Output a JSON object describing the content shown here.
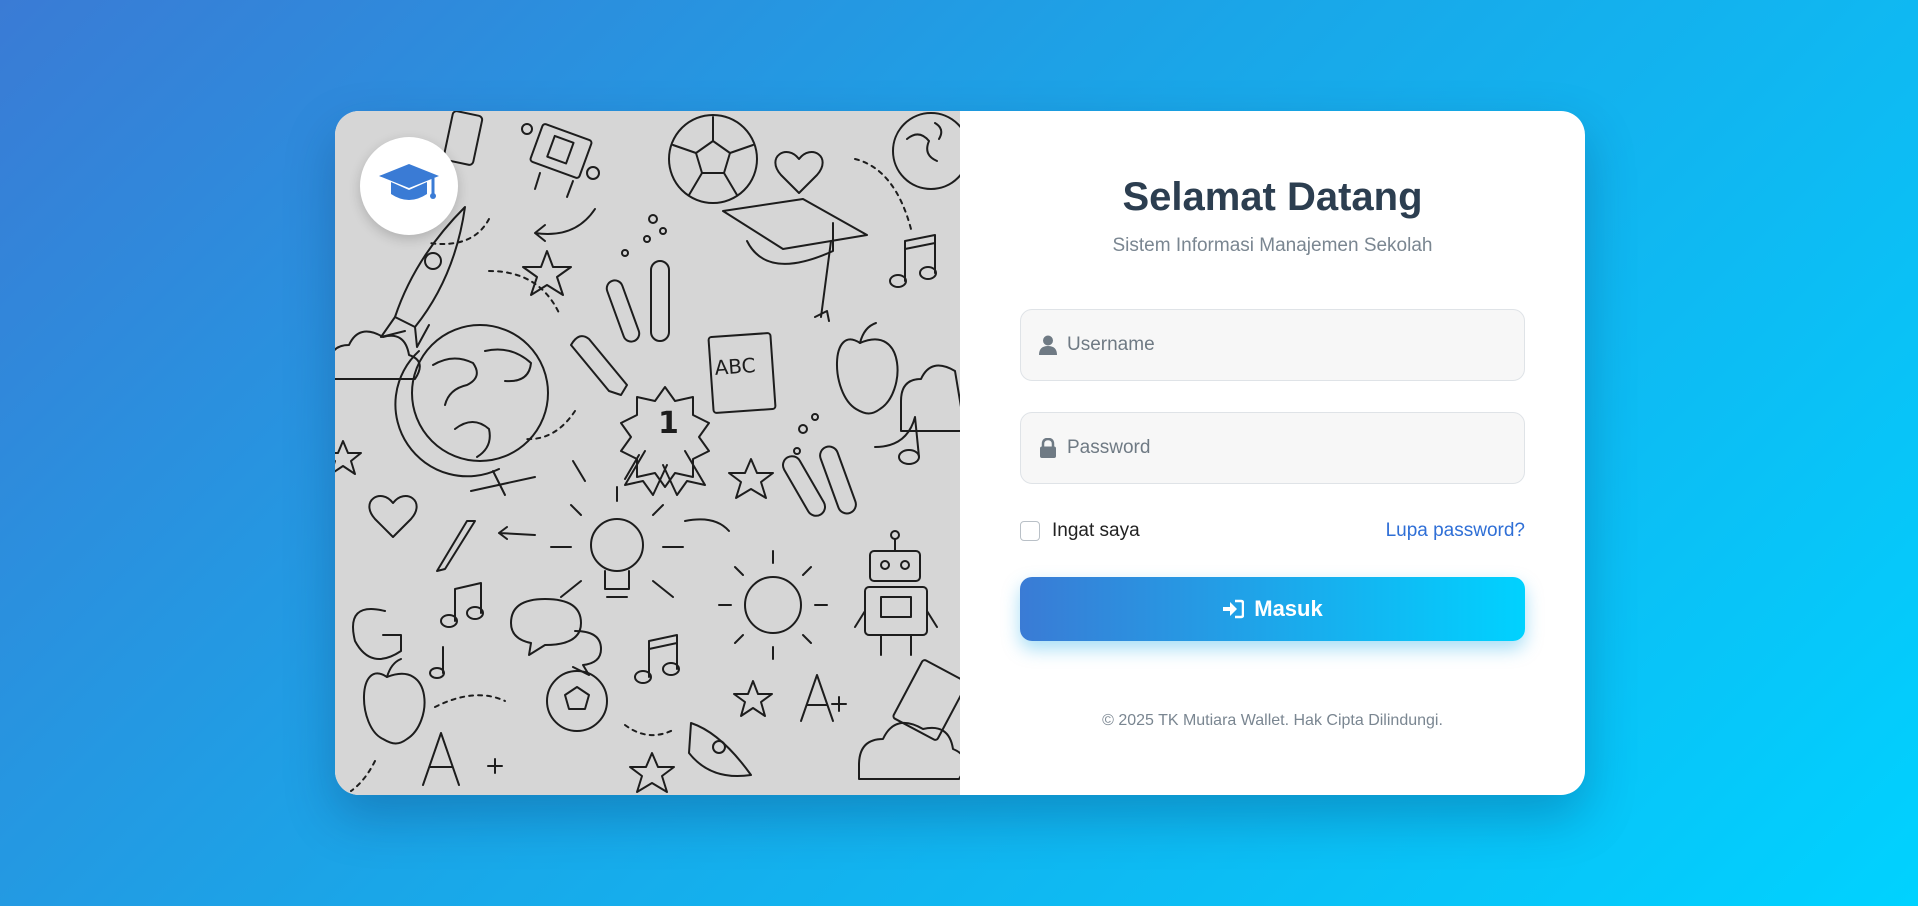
{
  "brand": {
    "logo_icon": "graduation-cap-icon",
    "accent_color": "#3a7bd5",
    "accent_color_end": "#00d2ff"
  },
  "header": {
    "title": "Selamat Datang",
    "subtitle": "Sistem Informasi Manajemen Sekolah"
  },
  "form": {
    "username": {
      "placeholder": "Username",
      "value": "",
      "icon": "user-icon"
    },
    "password": {
      "placeholder": "Password",
      "value": "",
      "icon": "lock-icon"
    },
    "remember_label": "Ingat saya",
    "remember_checked": false,
    "forgot_label": "Lupa password?",
    "submit_label": "Masuk",
    "submit_icon": "sign-in-icon"
  },
  "footer": {
    "copyright": "© 2025 TK Mutiara Wallet. Hak Cipta Dilindungi."
  },
  "illustration": {
    "abc_text": "ABC",
    "medal_text": "1",
    "grade_text": "A+"
  }
}
